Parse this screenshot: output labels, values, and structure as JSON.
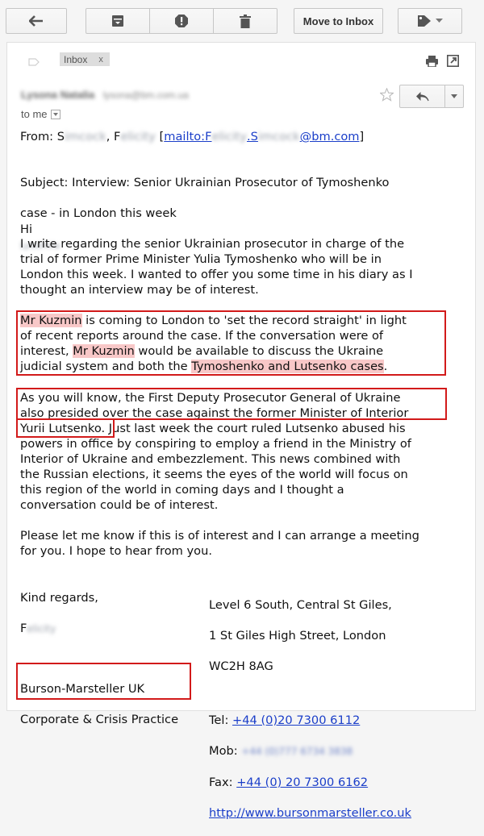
{
  "toolbar": {
    "move_to_inbox": "Move to Inbox"
  },
  "header": {
    "label_chip": "Inbox",
    "label_chip_close": "x",
    "sender_name": "Lysona Natalia",
    "sender_email": "lysona@bm.com.ua",
    "to_me": "to me"
  },
  "email": {
    "from_prefix": "From: S",
    "from_blur1": "imcock",
    "from_mid": ", F",
    "from_blur2": "elicity",
    "from_bracket_open": "[",
    "mailto_a": "mailto:F",
    "mailto_blur1": "elicity",
    "mailto_b": ".S",
    "mailto_blur2": "imcock",
    "mailto_c": "@bm.com",
    "from_bracket_close": "]",
    "subject_line1": "Subject: Interview: Senior Ukrainian Prosecutor of Tymoshenko",
    "subject_line2": "case - in London this week",
    "greeting": "Hi",
    "greeting_blur": "Lyudmila",
    "para1": "I write regarding the senior Ukrainian prosecutor in charge of the\ntrial of former Prime Minister Yulia Tymoshenko who will be in\nLondon this week. I wanted to offer you some time in his diary as I\nthought an interview may be of interest.",
    "p2_hl1": "Mr Kuzmin",
    "p2_t1": " is coming to London to 'set the record straight' in light\nof recent reports around the case. If the conversation were of\ninterest, ",
    "p2_hl2": "Mr Kuzmin",
    "p2_t2": " would be available to discuss the Ukraine\njudicial system and both the ",
    "p2_hl3": "Tymoshenko and Lutsenko cases",
    "p2_t3": ".",
    "para3": "As you will know, the First Deputy Prosecutor General of Ukraine\nalso presided over the case against the former Minister of Interior\nYurii Lutsenko. Just last week the court ruled Lutsenko abused his\npowers in office by conspiring to employ a friend in the Ministry of\nInterior of Ukraine and embezzlement. This news combined with\nthe Russian elections, it seems the eyes of the world will focus on\nthis region of the world in coming days and I thought a\nconversation could be of interest.",
    "para4": "Please let me know if this is of interest and I can arrange a meeting\nfor you. I hope to hear from you.",
    "closing": "Kind regards,",
    "sign_initial": "F",
    "sign_blur": "elicity",
    "company_line1": "Burson-Marsteller UK",
    "company_line2": "Corporate & Crisis Practice",
    "address1": "Level 6 South, Central St Giles,",
    "address2": "1 St Giles High Street, London",
    "address3": "WC2H 8AG",
    "tel_label": "Tel:",
    "tel_value": "+44 (0)20 7300 6112",
    "mob_label": "Mob:",
    "mob_blur": "+44 (0)777 6734 3838",
    "fax_label": "Fax:",
    "fax_value": "+44 (0) 20 7300 6162",
    "website": "http://www.bursonmarsteller.co.uk"
  },
  "colors": {
    "highlight": "#f8c8c8",
    "annotation_box": "#d21a1a",
    "link": "#1a3ec9"
  },
  "icons": [
    "back-arrow-icon",
    "archive-icon",
    "report-spam-icon",
    "trash-icon",
    "label-tag-icon",
    "chevron-down-icon",
    "print-icon",
    "open-new-window-icon",
    "star-icon",
    "reply-icon"
  ]
}
